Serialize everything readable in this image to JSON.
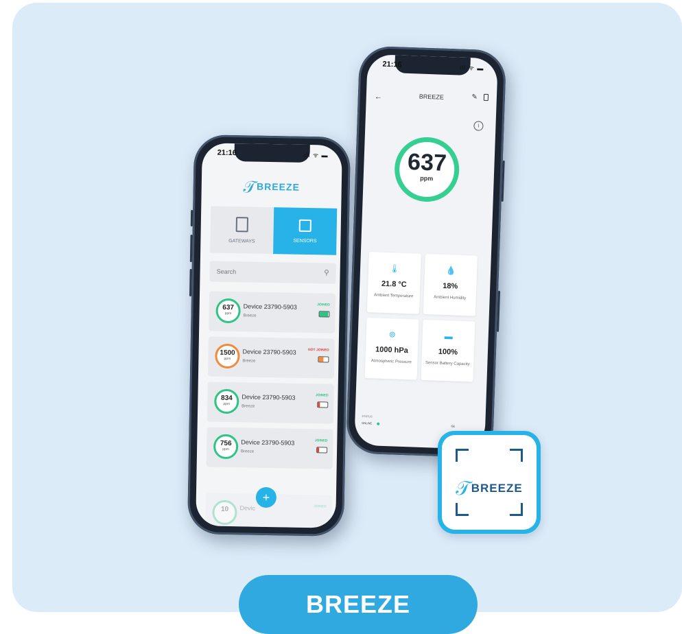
{
  "left_phone": {
    "time": "21:16",
    "status_icons": "ıll ᯤ ▬",
    "logo_text": "BREEZE",
    "tabs": [
      {
        "label": "GATEWAYS",
        "active": false
      },
      {
        "label": "SENSORS",
        "active": true
      }
    ],
    "search_placeholder": "Search",
    "devices": [
      {
        "value": "637",
        "unit": "ppm",
        "name": "Device 23790-5903",
        "sub": "Breeze",
        "status": "JOINED",
        "status_color": "#2ec486",
        "ring_color": "#2ec486",
        "battery_color": "#2ec486",
        "battery_level": 0.9
      },
      {
        "value": "1500",
        "unit": "ppm",
        "name": "Device 23790-5903",
        "sub": "Breeze",
        "status": "NOT JOINED",
        "status_color": "#e0433b",
        "ring_color": "#f08a3c",
        "battery_color": "#f08a3c",
        "battery_level": 0.5
      },
      {
        "value": "834",
        "unit": "ppm",
        "name": "Device 23790-5903",
        "sub": "Breeze",
        "status": "JOINED",
        "status_color": "#2ec486",
        "ring_color": "#2ec486",
        "battery_color": "#e0433b",
        "battery_level": 0.2
      },
      {
        "value": "756",
        "unit": "ppm",
        "name": "Device 23790-5903",
        "sub": "Breeze",
        "status": "JOINED",
        "status_color": "#2ec486",
        "ring_color": "#2ec486",
        "battery_color": "#e0433b",
        "battery_level": 0.2
      }
    ],
    "partial_device": {
      "value": "10",
      "name": "Devic",
      "suffix": "5903",
      "status": "JOINED"
    },
    "fab_label": "+"
  },
  "right_phone": {
    "time": "21:16",
    "status_icons": "ıll ᯤ ▬",
    "title": "BREEZE",
    "back_icon": "←",
    "edit_icon": "✎",
    "gauge_value": "637",
    "gauge_unit": "ppm",
    "tiles": [
      {
        "icon": "thermometer-icon",
        "glyph": "🌡",
        "value": "21.8 °C",
        "label": "Ambient Temperature"
      },
      {
        "icon": "humidity-icon",
        "glyph": "💧",
        "value": "18%",
        "label": "Ambient Humidity"
      },
      {
        "icon": "pressure-icon",
        "glyph": "⊚",
        "value": "1000 hPa",
        "label": "Atmospheric Pressure"
      },
      {
        "icon": "battery-icon",
        "glyph": "▬",
        "value": "100%",
        "label": "Sensor Battery Capacity"
      }
    ],
    "status_label": "STATUS",
    "status_value": "ONLINE",
    "status_right": "GE"
  },
  "app_icon": {
    "text": "BREEZE"
  },
  "pill_label": "BREEZE",
  "colors": {
    "accent": "#27b3e8",
    "ok": "#2ec486",
    "bg": "#dcebf8"
  }
}
